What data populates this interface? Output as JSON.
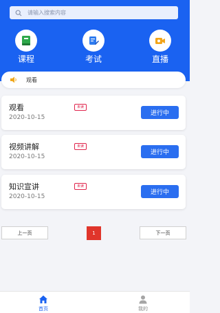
{
  "search": {
    "placeholder": "请输入搜索内容"
  },
  "categories": [
    {
      "label": "课程",
      "icon": "book-icon"
    },
    {
      "label": "考试",
      "icon": "exam-edit-icon"
    },
    {
      "label": "直播",
      "icon": "live-video-icon"
    }
  ],
  "notice": {
    "text": "观看",
    "icon": "speaker-icon"
  },
  "courses": [
    {
      "title": "观看",
      "date": "2020-10-15",
      "badge": "未读",
      "action": "进行中"
    },
    {
      "title": "视频讲解",
      "date": "2020-10-15",
      "badge": "未读",
      "action": "进行中"
    },
    {
      "title": "知识宣讲",
      "date": "2020-10-15",
      "badge": "未读",
      "action": "进行中"
    }
  ],
  "pagination": {
    "prev": "上一页",
    "current": "1",
    "next": "下一页"
  },
  "tabbar": [
    {
      "label": "首页",
      "icon": "home-icon",
      "active": true
    },
    {
      "label": "我的",
      "icon": "user-icon",
      "active": false
    }
  ],
  "colors": {
    "primary": "#1a62f1",
    "button": "#2a6ef0",
    "badge": "#e0224a",
    "page_active": "#e0352b"
  }
}
